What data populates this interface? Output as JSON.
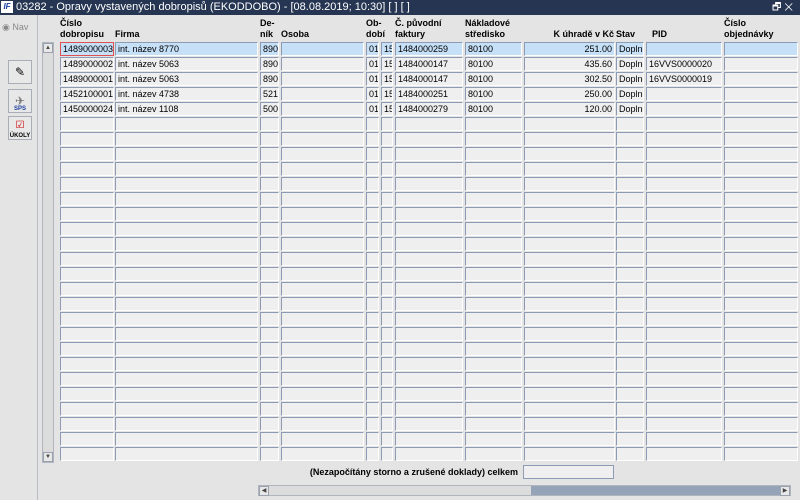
{
  "window": {
    "title": "03282 - Opravy vystavených dobropisů (EKODDOBO) - [08.08.2019; 10:30]  [ ]  [ ]",
    "app_icon": "IF",
    "restore_icon": "restore-icon",
    "close_icon": "close-icon"
  },
  "sidebar": {
    "nav_label": "Nav",
    "tools": [
      {
        "icon": "edit-document-icon",
        "label": ""
      },
      {
        "icon": "sps-plane-icon",
        "label": "SPS"
      },
      {
        "icon": "checklist-icon",
        "label": "ÚKOLY"
      }
    ]
  },
  "columns": [
    {
      "key": "cislo",
      "label1": "Číslo",
      "label2": "dobropisu"
    },
    {
      "key": "firma",
      "label1": "",
      "label2": "Firma"
    },
    {
      "key": "denik",
      "label1": "De-",
      "label2": "ník"
    },
    {
      "key": "osoba",
      "label1": "",
      "label2": "Osoba"
    },
    {
      "key": "obdobi",
      "label1": "Ob-",
      "label2": "dobí"
    },
    {
      "key": "obdobi2",
      "label1": "",
      "label2": ""
    },
    {
      "key": "faktura",
      "label1": "Č. původní",
      "label2": "faktury"
    },
    {
      "key": "stredisko",
      "label1": "Nákladové",
      "label2": "středisko"
    },
    {
      "key": "uhrada",
      "label1": "",
      "label2": "K úhradě v Kč"
    },
    {
      "key": "stav",
      "label1": "",
      "label2": "Stav"
    },
    {
      "key": "pid",
      "label1": "",
      "label2": "PID"
    },
    {
      "key": "objednavka",
      "label1": "Číslo",
      "label2": "objednávky"
    }
  ],
  "rows": [
    [
      "1489000003",
      "int. název 8770",
      "890",
      "",
      "01",
      "15",
      "1484000259",
      "80100",
      "251.00",
      "Doplně",
      "",
      ""
    ],
    [
      "1489000002",
      "int. název 5063",
      "890",
      "",
      "01",
      "15",
      "1484000147",
      "80100",
      "435.60",
      "Doplně",
      "16VVS0000020",
      ""
    ],
    [
      "1489000001",
      "int. název 5063",
      "890",
      "",
      "01",
      "15",
      "1484000147",
      "80100",
      "302.50",
      "Doplně",
      "16VVS0000019",
      ""
    ],
    [
      "1452100001",
      "int. název 4738",
      "521",
      "",
      "01",
      "15",
      "1484000251",
      "80100",
      "250.00",
      "Doplně",
      "",
      ""
    ],
    [
      "1450000024",
      "int. název 1108",
      "500",
      "",
      "01",
      "15",
      "1484000279",
      "80100",
      "120.00",
      "Doplně",
      "",
      ""
    ]
  ],
  "footer": {
    "total_label": "(Nezapočítány storno a zrušené doklady) celkem",
    "total_value": ""
  }
}
